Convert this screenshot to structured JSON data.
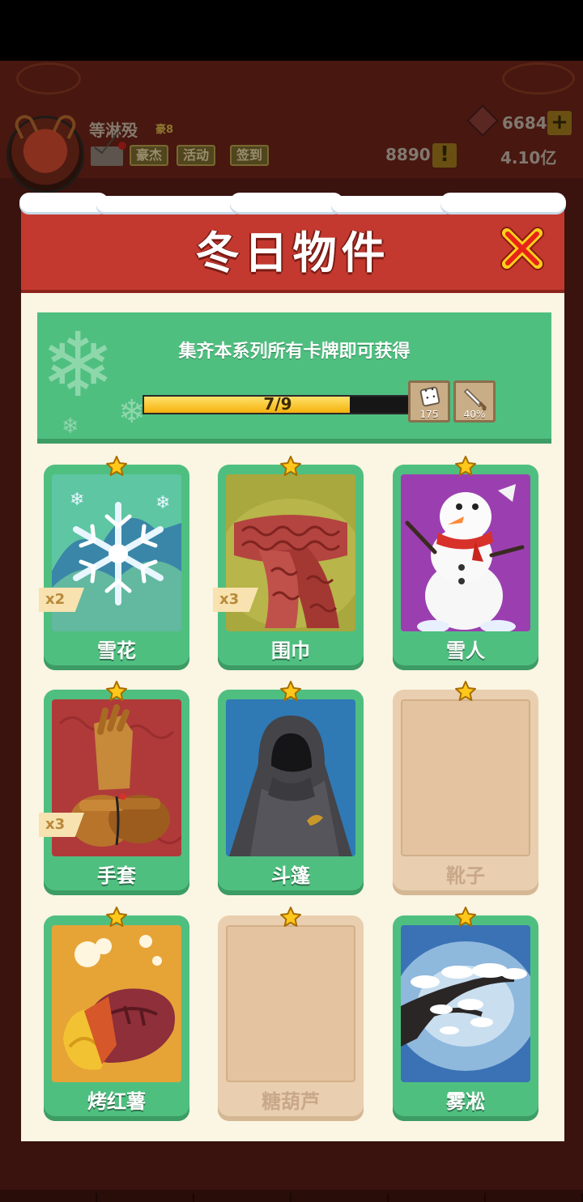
{
  "background": {
    "player_name": "等淋殁",
    "player_tag": "豪8",
    "buttons": [
      "豪杰",
      "活动",
      "签到"
    ],
    "gems": "6684",
    "tickets": "8890",
    "gold": "4.10亿",
    "plus_label": "+",
    "alert_label": "!"
  },
  "modal": {
    "title": "冬日物件",
    "close_icon": "close-x-icon",
    "banner": {
      "text": "集齐本系列所有卡牌即可获得",
      "progress": {
        "current": 7,
        "total": 9,
        "label": "7/9"
      },
      "rewards": [
        {
          "icon": "dice-icon",
          "label": "175"
        },
        {
          "icon": "sword-icon",
          "label": "40%"
        }
      ]
    },
    "cards": [
      {
        "name": "雪花",
        "count": "x2",
        "owned": true,
        "art": "snowflake"
      },
      {
        "name": "围巾",
        "count": "x3",
        "owned": true,
        "art": "scarf"
      },
      {
        "name": "雪人",
        "count": "",
        "owned": true,
        "art": "snowman"
      },
      {
        "name": "手套",
        "count": "x3",
        "owned": true,
        "art": "gloves"
      },
      {
        "name": "斗篷",
        "count": "",
        "owned": true,
        "art": "cloak"
      },
      {
        "name": "靴子",
        "count": "",
        "owned": false,
        "art": ""
      },
      {
        "name": "烤红薯",
        "count": "",
        "owned": true,
        "art": "sweet-potato"
      },
      {
        "name": "糖葫芦",
        "count": "",
        "owned": false,
        "art": ""
      },
      {
        "name": "雾凇",
        "count": "",
        "owned": true,
        "art": "rime-tree"
      }
    ]
  },
  "colors": {
    "header_red": "#c3392f",
    "card_green": "#4fbf80",
    "locked_tan": "#e9cfb0",
    "panel_cream": "#fbf5e3",
    "progress_yellow": "#f5b10d"
  }
}
